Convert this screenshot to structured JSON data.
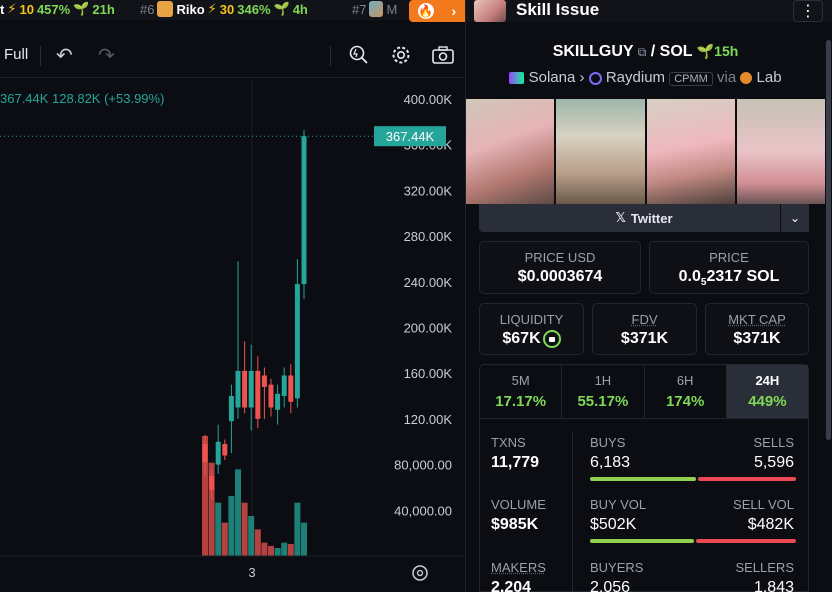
{
  "ticker": [
    {
      "rank": "",
      "symbol": "t",
      "boost": "10",
      "pct": "457%",
      "age": "21h"
    },
    {
      "rank": "#6",
      "symbol": "Riko",
      "boost": "30",
      "pct": "346%",
      "age": "4h"
    },
    {
      "rank": "#7",
      "symbol": "M",
      "boost": "",
      "pct": "",
      "age": ""
    }
  ],
  "chart": {
    "toolbar": {
      "full_label": "Full"
    },
    "legend": "367.44K  128.82K (+53.99%)",
    "current_price_label": "367.44K",
    "x_tick": "3"
  },
  "chart_data": {
    "type": "candlestick",
    "y_ticks": [
      "400.00K",
      "360.00K",
      "320.00K",
      "280.00K",
      "240.00K",
      "200.00K",
      "160.00K",
      "120.00K",
      "80,000.00",
      "40,000.00"
    ],
    "ylim": [
      0,
      400000
    ],
    "current_price": 367440,
    "candles": [
      {
        "o": 98000,
        "c": 82000,
        "h": 106000,
        "l": 70000,
        "v": 18000,
        "up": false
      },
      {
        "o": 70000,
        "c": 58000,
        "h": 75000,
        "l": 50000,
        "v": 14000,
        "up": false
      },
      {
        "o": 80000,
        "c": 100000,
        "h": 115000,
        "l": 72000,
        "v": 8000,
        "up": true
      },
      {
        "o": 98000,
        "c": 88000,
        "h": 102000,
        "l": 84000,
        "v": 5000,
        "up": false
      },
      {
        "o": 118000,
        "c": 140000,
        "h": 150000,
        "l": 90000,
        "v": 9000,
        "up": true
      },
      {
        "o": 130000,
        "c": 162000,
        "h": 258000,
        "l": 120000,
        "v": 13000,
        "up": true
      },
      {
        "o": 162000,
        "c": 130000,
        "h": 188000,
        "l": 125000,
        "v": 8000,
        "up": false
      },
      {
        "o": 130000,
        "c": 162000,
        "h": 185000,
        "l": 110000,
        "v": 6000,
        "up": true
      },
      {
        "o": 162000,
        "c": 120000,
        "h": 175000,
        "l": 112000,
        "v": 4000,
        "up": false
      },
      {
        "o": 158000,
        "c": 148000,
        "h": 165000,
        "l": 120000,
        "v": 2000,
        "up": false
      },
      {
        "o": 150000,
        "c": 130000,
        "h": 155000,
        "l": 122000,
        "v": 1500,
        "up": false
      },
      {
        "o": 128000,
        "c": 142000,
        "h": 150000,
        "l": 115000,
        "v": 1200,
        "up": true
      },
      {
        "o": 140000,
        "c": 158000,
        "h": 165000,
        "l": 130000,
        "v": 2000,
        "up": true
      },
      {
        "o": 158000,
        "c": 135000,
        "h": 168000,
        "l": 125000,
        "v": 1800,
        "up": false
      },
      {
        "o": 138000,
        "c": 238000,
        "h": 260000,
        "l": 130000,
        "v": 8000,
        "up": true
      },
      {
        "o": 238000,
        "c": 367440,
        "h": 373000,
        "l": 225000,
        "v": 5000,
        "up": true
      }
    ]
  },
  "pair": {
    "header_name": "Skill Issue",
    "base": "SKILLGUY",
    "quote": "SOL",
    "age": "15h",
    "chain": "Solana",
    "dex": "Raydium",
    "dex_type": "CPMM",
    "via_label": "via",
    "via_name": "Lab",
    "twitter_label": "Twitter"
  },
  "metrics": {
    "price_usd_label": "PRICE USD",
    "price_usd": "$0.0003674",
    "price_label": "PRICE",
    "price_prefix": "0.0",
    "price_sub": "5",
    "price_rest": "2317 SOL",
    "liquidity_label": "LIQUIDITY",
    "liquidity": "$67K",
    "fdv_label": "FDV",
    "fdv": "$371K",
    "mktcap_label": "MKT CAP",
    "mktcap": "$371K"
  },
  "timeframes": [
    {
      "label": "5M",
      "value": "17.17%"
    },
    {
      "label": "1H",
      "value": "55.17%"
    },
    {
      "label": "6H",
      "value": "174%"
    },
    {
      "label": "24H",
      "value": "449%",
      "active": true
    }
  ],
  "stats": {
    "txns_label": "TXNS",
    "txns": "11,779",
    "buys_label": "BUYS",
    "buys": "6,183",
    "sells_label": "SELLS",
    "sells": "5,596",
    "volume_label": "VOLUME",
    "volume": "$985K",
    "buy_vol_label": "BUY VOL",
    "buy_vol": "$502K",
    "sell_vol_label": "SELL VOL",
    "sell_vol": "$482K",
    "makers_label": "MAKERS",
    "makers": "2,204",
    "buyers_label": "BUYERS",
    "buyers": "2,056",
    "sellers_label": "SELLERS",
    "sellers": "1,843"
  },
  "colors": {
    "up": "#26a69a",
    "down": "#ef5350",
    "accent": "#f27a1d",
    "positive": "#7ed957"
  }
}
